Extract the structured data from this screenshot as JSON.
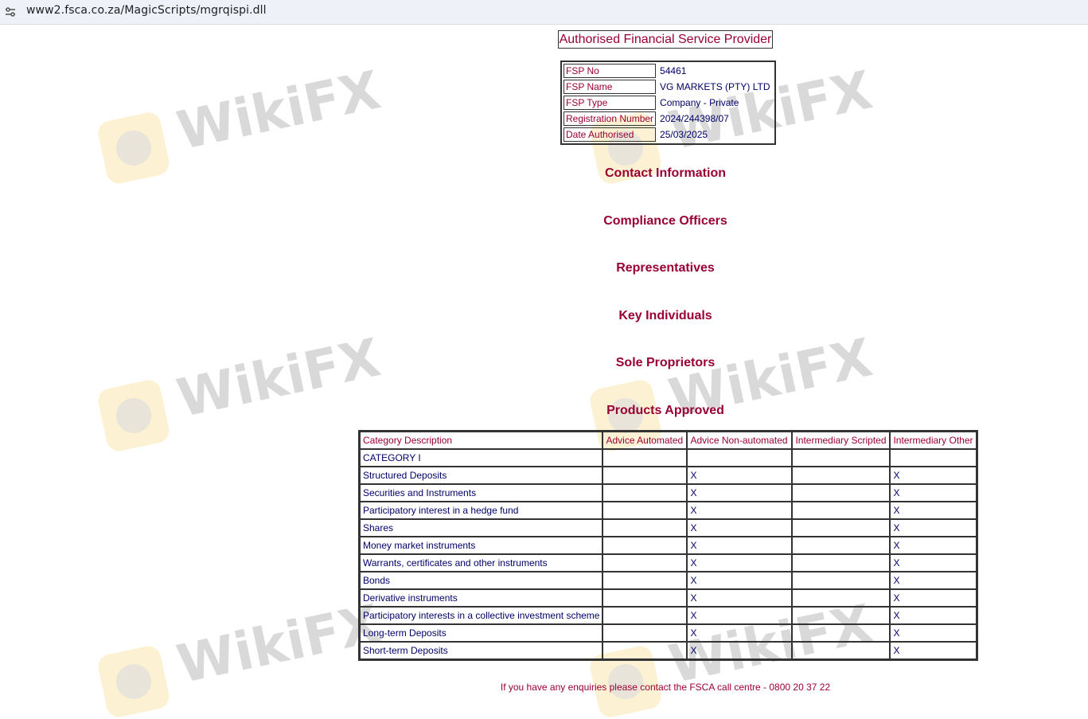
{
  "browser": {
    "url": "www2.fsca.co.za/MagicScripts/mgrqispi.dll",
    "site_info_icon": "tune-icon"
  },
  "watermark": {
    "text": "WikiFX",
    "logo_icon": "wikifx-eagle-icon"
  },
  "page": {
    "title": "Authorised Financial Service Provider",
    "fsp": [
      {
        "label": "FSP No",
        "value": "54461"
      },
      {
        "label": "FSP Name",
        "value": "VG MARKETS (PTY) LTD"
      },
      {
        "label": "FSP Type",
        "value": "Company - Private"
      },
      {
        "label": "Registration Number",
        "value": "2024/244398/07"
      },
      {
        "label": "Date Authorised",
        "value": "25/03/2025"
      }
    ],
    "sections": {
      "contact": "Contact Information",
      "compliance": "Compliance Officers",
      "representatives": "Representatives",
      "key_individuals": "Key Individuals",
      "sole_proprietors": "Sole Proprietors",
      "products": "Products Approved"
    },
    "products_table": {
      "headers": [
        "Category Description",
        "Advice Automated",
        "Advice Non-automated",
        "Intermediary Scripted",
        "Intermediary Other"
      ],
      "rows": [
        [
          "CATEGORY I",
          "",
          "",
          "",
          ""
        ],
        [
          "Structured Deposits",
          "",
          "X",
          "",
          "X"
        ],
        [
          "Securities and Instruments",
          "",
          "X",
          "",
          "X"
        ],
        [
          "Participatory interest in a hedge fund",
          "",
          "X",
          "",
          "X"
        ],
        [
          "Shares",
          "",
          "X",
          "",
          "X"
        ],
        [
          "Money market instruments",
          "",
          "X",
          "",
          "X"
        ],
        [
          "Warrants, certificates and other instruments",
          "",
          "X",
          "",
          "X"
        ],
        [
          "Bonds",
          "",
          "X",
          "",
          "X"
        ],
        [
          "Derivative instruments",
          "",
          "X",
          "",
          "X"
        ],
        [
          "Participatory interests in a collective investment scheme",
          "",
          "X",
          "",
          "X"
        ],
        [
          "Long-term Deposits",
          "",
          "X",
          "",
          "X"
        ],
        [
          "Short-term Deposits",
          "",
          "X",
          "",
          "X"
        ]
      ]
    },
    "footer": "If you have any enquiries please contact the FSCA call centre - 0800 20 37 22"
  }
}
